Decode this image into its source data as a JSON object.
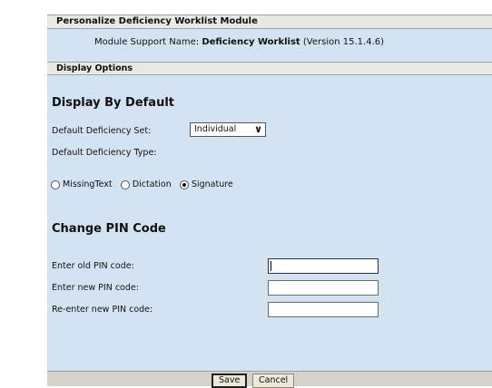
{
  "window": {
    "title": "Personalize Deficiency Worklist Module"
  },
  "module": {
    "support_label": "Module Support Name:",
    "support_name": "Deficiency Worklist",
    "version": "(Version 15.1.4.6)"
  },
  "section": {
    "title": "Display Options"
  },
  "display_default": {
    "heading": "Display By Default",
    "set_label": "Default Deficiency Set:",
    "set_value": "Individual",
    "type_label": "Default Deficiency Type:",
    "types": [
      {
        "label": "MissingText",
        "selected": false
      },
      {
        "label": "Dictation",
        "selected": false
      },
      {
        "label": "Signature",
        "selected": true
      }
    ]
  },
  "pin": {
    "heading": "Change PIN Code",
    "fields": [
      {
        "label": "Enter old PIN code:",
        "value": ""
      },
      {
        "label": "Enter new PIN code:",
        "value": ""
      },
      {
        "label": "Re-enter new PIN code:",
        "value": ""
      }
    ]
  },
  "footer": {
    "save_label": "Save",
    "cancel_label": "Cancel"
  },
  "icons": {
    "chevron": "chevron-down-icon"
  }
}
